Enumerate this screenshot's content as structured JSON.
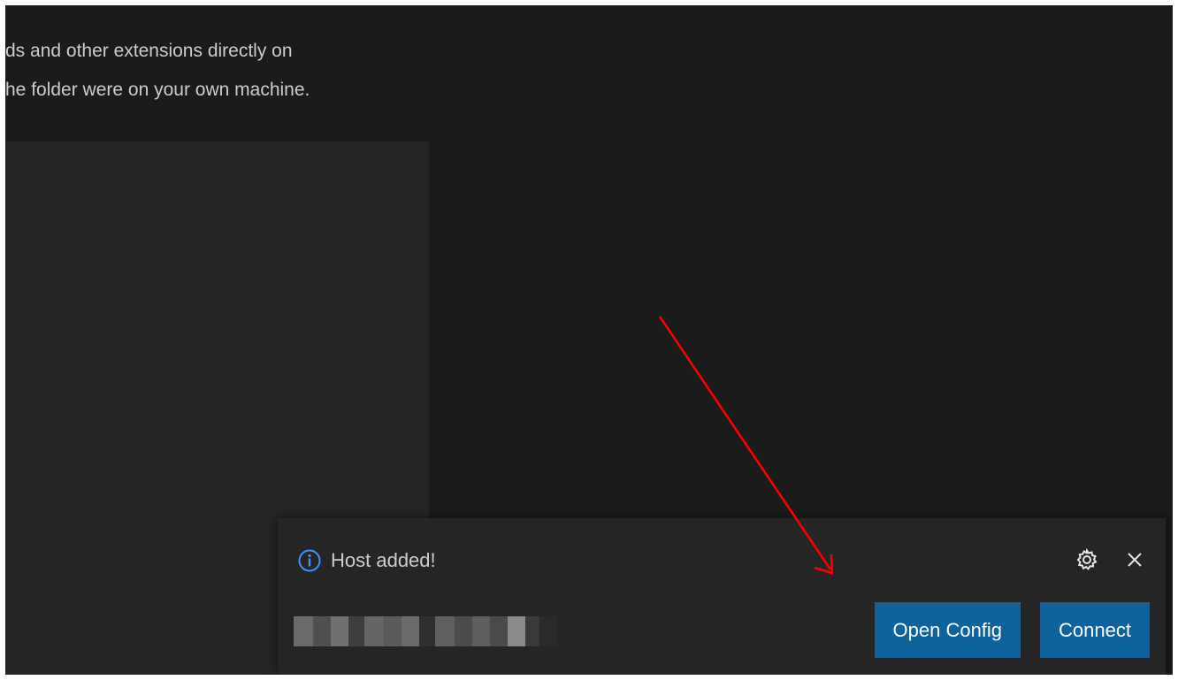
{
  "walkthrough": {
    "line1": "ds and other extensions directly on",
    "line2": "he folder were on your own machine."
  },
  "notification": {
    "message": "Host added!",
    "severity_icon": "info-icon",
    "settings_icon": "gear-icon",
    "close_icon": "close-icon",
    "buttons": {
      "open_config": "Open Config",
      "connect": "Connect"
    }
  },
  "colors": {
    "editor_background": "#1b1b1c",
    "panel_background": "#252527",
    "notification_background": "#252526",
    "button_background": "#0e639c",
    "info_icon": "#3794ff",
    "annotation_arrow": "#ff0000"
  }
}
